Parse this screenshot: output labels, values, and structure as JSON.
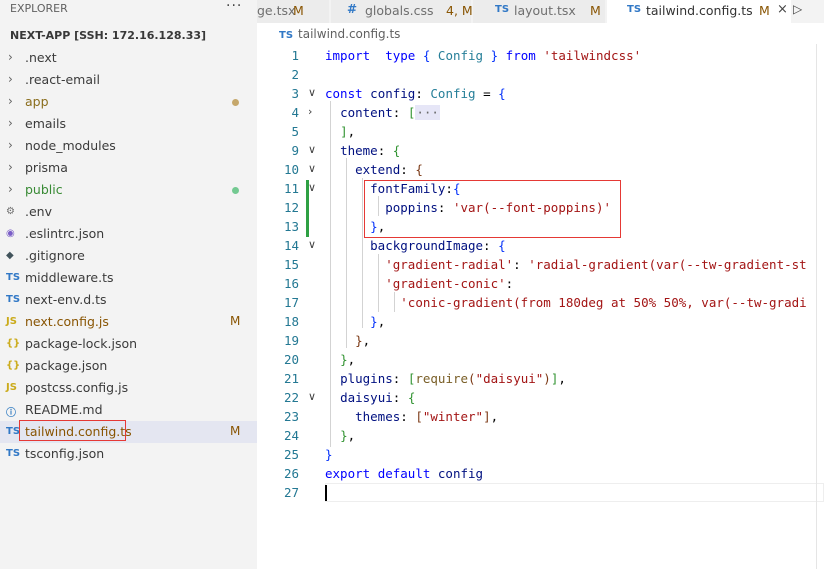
{
  "explorer": {
    "title": "EXPLORER",
    "more": "···",
    "project": "NEXT-APP [SSH: 172.16.128.33]",
    "items": [
      {
        "label": ".next",
        "kind": "folder",
        "badge": "",
        "dot": ""
      },
      {
        "label": ".react-email",
        "kind": "folder",
        "badge": "",
        "dot": ""
      },
      {
        "label": "app",
        "kind": "folder",
        "badge": "",
        "dot": "#c5a76b",
        "color": "#8a6d1c"
      },
      {
        "label": "emails",
        "kind": "folder",
        "badge": "",
        "dot": ""
      },
      {
        "label": "node_modules",
        "kind": "folder",
        "badge": "",
        "dot": ""
      },
      {
        "label": "prisma",
        "kind": "folder",
        "badge": "",
        "dot": ""
      },
      {
        "label": "public",
        "kind": "folder",
        "badge": "",
        "dot": "#73c991",
        "color": "#388a34"
      },
      {
        "label": ".env",
        "kind": "file",
        "icon": "⚙",
        "icon_color": "#6d6d6d",
        "badge": ""
      },
      {
        "label": ".eslintrc.json",
        "kind": "file",
        "icon": "◉",
        "icon_color": "#7a5ec7",
        "badge": ""
      },
      {
        "label": ".gitignore",
        "kind": "file",
        "icon": "◆",
        "icon_color": "#41535b",
        "badge": ""
      },
      {
        "label": "middleware.ts",
        "kind": "file",
        "icon": "TS",
        "icon_color": "#3178c6",
        "badge": ""
      },
      {
        "label": "next-env.d.ts",
        "kind": "file",
        "icon": "TS",
        "icon_color": "#3178c6",
        "badge": ""
      },
      {
        "label": "next.config.js",
        "kind": "file",
        "icon": "JS",
        "icon_color": "#cbab1b",
        "badge": "M",
        "color": "#895503"
      },
      {
        "label": "package-lock.json",
        "kind": "file",
        "icon": "{}",
        "icon_color": "#cbab1b",
        "badge": ""
      },
      {
        "label": "package.json",
        "kind": "file",
        "icon": "{}",
        "icon_color": "#cbab1b",
        "badge": ""
      },
      {
        "label": "postcss.config.js",
        "kind": "file",
        "icon": "JS",
        "icon_color": "#cbab1b",
        "badge": ""
      },
      {
        "label": "README.md",
        "kind": "file",
        "icon": "ⓘ",
        "icon_color": "#3b82c4",
        "badge": ""
      },
      {
        "label": "tailwind.config.ts",
        "kind": "file",
        "icon": "TS",
        "icon_color": "#3178c6",
        "badge": "M",
        "color": "#895503",
        "active": true
      },
      {
        "label": "tsconfig.json",
        "kind": "file",
        "icon": "TS",
        "icon_color": "#3178c6",
        "badge": ""
      }
    ]
  },
  "tabs": [
    {
      "label": "ge.tsx",
      "mod": "M",
      "icon": "",
      "icon_color": "#3178c6"
    },
    {
      "label": "globals.css",
      "mod": "4, M",
      "icon": "#",
      "icon_color": "#3178c6"
    },
    {
      "label": "layout.tsx",
      "mod": "M",
      "icon": "TS",
      "icon_color": "#3178c6"
    },
    {
      "label": "tailwind.config.ts",
      "mod": "M",
      "icon": "TS",
      "icon_color": "#3178c6",
      "active": true,
      "close": "×"
    }
  ],
  "run_icon": "▷",
  "breadcrumb": {
    "icon": "TS",
    "file": "tailwind.config.ts"
  },
  "editor": {
    "lines": [
      {
        "n": "1",
        "fold": "",
        "code": [
          [
            "kw",
            "import"
          ],
          [
            "",
            "  "
          ],
          [
            "kw",
            "type"
          ],
          [
            "",
            " "
          ],
          [
            "br1",
            "{"
          ],
          [
            "",
            " "
          ],
          [
            "tp",
            "Config"
          ],
          [
            "",
            " "
          ],
          [
            "br1",
            "}"
          ],
          [
            "",
            " "
          ],
          [
            "kw",
            "from"
          ],
          [
            "",
            " "
          ],
          [
            "str",
            "'tailwindcss'"
          ]
        ]
      },
      {
        "n": "2",
        "fold": "",
        "code": []
      },
      {
        "n": "3",
        "fold": "∨",
        "code": [
          [
            "kw",
            "const"
          ],
          [
            "",
            " "
          ],
          [
            "prop",
            "config"
          ],
          [
            "",
            ": "
          ],
          [
            "tp",
            "Config"
          ],
          [
            "",
            " = "
          ],
          [
            "br1",
            "{"
          ]
        ]
      },
      {
        "n": "4",
        "fold": "›",
        "code": [
          [
            "",
            "  "
          ],
          [
            "prop",
            "content"
          ],
          [
            "",
            ": "
          ],
          [
            "br2",
            "["
          ],
          [
            "folded",
            "···"
          ]
        ]
      },
      {
        "n": "5",
        "fold": "",
        "code": [
          [
            "",
            "  "
          ],
          [
            "br2",
            "]"
          ],
          [
            "",
            ","
          ]
        ]
      },
      {
        "n": "9",
        "fold": "∨",
        "code": [
          [
            "",
            "  "
          ],
          [
            "prop",
            "theme"
          ],
          [
            "",
            ": "
          ],
          [
            "br2",
            "{"
          ]
        ]
      },
      {
        "n": "10",
        "fold": "∨",
        "code": [
          [
            "",
            "    "
          ],
          [
            "prop",
            "extend"
          ],
          [
            "",
            ": "
          ],
          [
            "br3",
            "{"
          ]
        ]
      },
      {
        "n": "11",
        "fold": "∨",
        "code": [
          [
            "",
            "      "
          ],
          [
            "prop",
            "fontFamily"
          ],
          [
            "",
            ":"
          ],
          [
            "br1",
            "{"
          ]
        ]
      },
      {
        "n": "12",
        "fold": "",
        "code": [
          [
            "",
            "        "
          ],
          [
            "prop",
            "poppins"
          ],
          [
            "",
            ": "
          ],
          [
            "str",
            "'var(--font-poppins)'"
          ]
        ]
      },
      {
        "n": "13",
        "fold": "",
        "code": [
          [
            "",
            "      "
          ],
          [
            "br1",
            "}"
          ],
          [
            "",
            ","
          ]
        ]
      },
      {
        "n": "14",
        "fold": "∨",
        "code": [
          [
            "",
            "      "
          ],
          [
            "prop",
            "backgroundImage"
          ],
          [
            "",
            ": "
          ],
          [
            "br1",
            "{"
          ]
        ]
      },
      {
        "n": "15",
        "fold": "",
        "code": [
          [
            "",
            "        "
          ],
          [
            "str",
            "'gradient-radial'"
          ],
          [
            "",
            ": "
          ],
          [
            "str",
            "'radial-gradient(var(--tw-gradient-st"
          ]
        ]
      },
      {
        "n": "16",
        "fold": "",
        "code": [
          [
            "",
            "        "
          ],
          [
            "str",
            "'gradient-conic'"
          ],
          [
            "",
            ":"
          ]
        ]
      },
      {
        "n": "17",
        "fold": "",
        "code": [
          [
            "",
            "          "
          ],
          [
            "str",
            "'conic-gradient(from 180deg at 50% 50%, var(--tw-gradi"
          ]
        ]
      },
      {
        "n": "18",
        "fold": "",
        "code": [
          [
            "",
            "      "
          ],
          [
            "br1",
            "}"
          ],
          [
            "",
            ","
          ]
        ]
      },
      {
        "n": "19",
        "fold": "",
        "code": [
          [
            "",
            "    "
          ],
          [
            "br3",
            "}"
          ],
          [
            "",
            ","
          ]
        ]
      },
      {
        "n": "20",
        "fold": "",
        "code": [
          [
            "",
            "  "
          ],
          [
            "br2",
            "}"
          ],
          [
            "",
            ","
          ]
        ]
      },
      {
        "n": "21",
        "fold": "",
        "code": [
          [
            "",
            "  "
          ],
          [
            "prop",
            "plugins"
          ],
          [
            "",
            ": "
          ],
          [
            "br2",
            "["
          ],
          [
            "fn",
            "require"
          ],
          [
            "br3",
            "("
          ],
          [
            "str",
            "\"daisyui\""
          ],
          [
            "br3",
            ")"
          ],
          [
            "br2",
            "]"
          ],
          [
            "",
            ","
          ]
        ]
      },
      {
        "n": "22",
        "fold": "∨",
        "code": [
          [
            "",
            "  "
          ],
          [
            "prop",
            "daisyui"
          ],
          [
            "",
            ": "
          ],
          [
            "br2",
            "{"
          ]
        ]
      },
      {
        "n": "23",
        "fold": "",
        "code": [
          [
            "",
            "    "
          ],
          [
            "prop",
            "themes"
          ],
          [
            "",
            ": "
          ],
          [
            "br3",
            "["
          ],
          [
            "str",
            "\"winter\""
          ],
          [
            "br3",
            "]"
          ],
          [
            "",
            ","
          ]
        ]
      },
      {
        "n": "24",
        "fold": "",
        "code": [
          [
            "",
            "  "
          ],
          [
            "br2",
            "}"
          ],
          [
            "",
            ","
          ]
        ]
      },
      {
        "n": "25",
        "fold": "",
        "code": [
          [
            "br1",
            "}"
          ]
        ]
      },
      {
        "n": "26",
        "fold": "",
        "code": [
          [
            "kw",
            "export"
          ],
          [
            "",
            " "
          ],
          [
            "kw",
            "default"
          ],
          [
            "",
            " "
          ],
          [
            "prop",
            "config"
          ]
        ]
      },
      {
        "n": "27",
        "fold": "",
        "code": [],
        "current": true
      }
    ]
  }
}
